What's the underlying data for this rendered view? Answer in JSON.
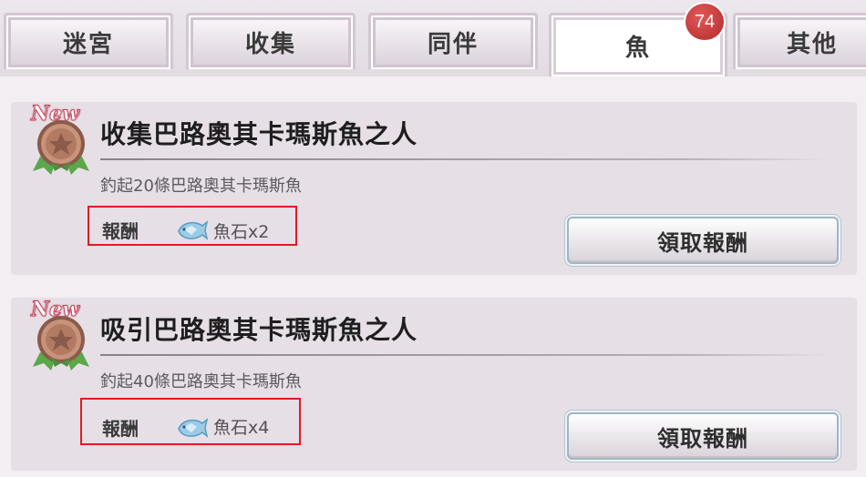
{
  "tabs": [
    {
      "label": "迷宮"
    },
    {
      "label": "收集"
    },
    {
      "label": "同伴"
    },
    {
      "label": "魚"
    },
    {
      "label": "其他"
    }
  ],
  "badge_count": "74",
  "quests": [
    {
      "new_tag": "New",
      "title": "收集巴路奧其卡瑪斯魚之人",
      "description": "釣起20條巴路奧其卡瑪斯魚",
      "reward_label": "報酬",
      "reward_value": "魚石x2",
      "reward_icon": "fish-stone-icon",
      "button_label": "領取報酬"
    },
    {
      "new_tag": "New",
      "title": "吸引巴路奧其卡瑪斯魚之人",
      "description": "釣起40條巴路奧其卡瑪斯魚",
      "reward_label": "報酬",
      "reward_value": "魚石x4",
      "reward_icon": "fish-stone-icon",
      "button_label": "領取報酬"
    }
  ],
  "colors": {
    "highlight_box": "#e01b24",
    "badge": "#c23333",
    "card_bg": "#e6dfe6"
  }
}
